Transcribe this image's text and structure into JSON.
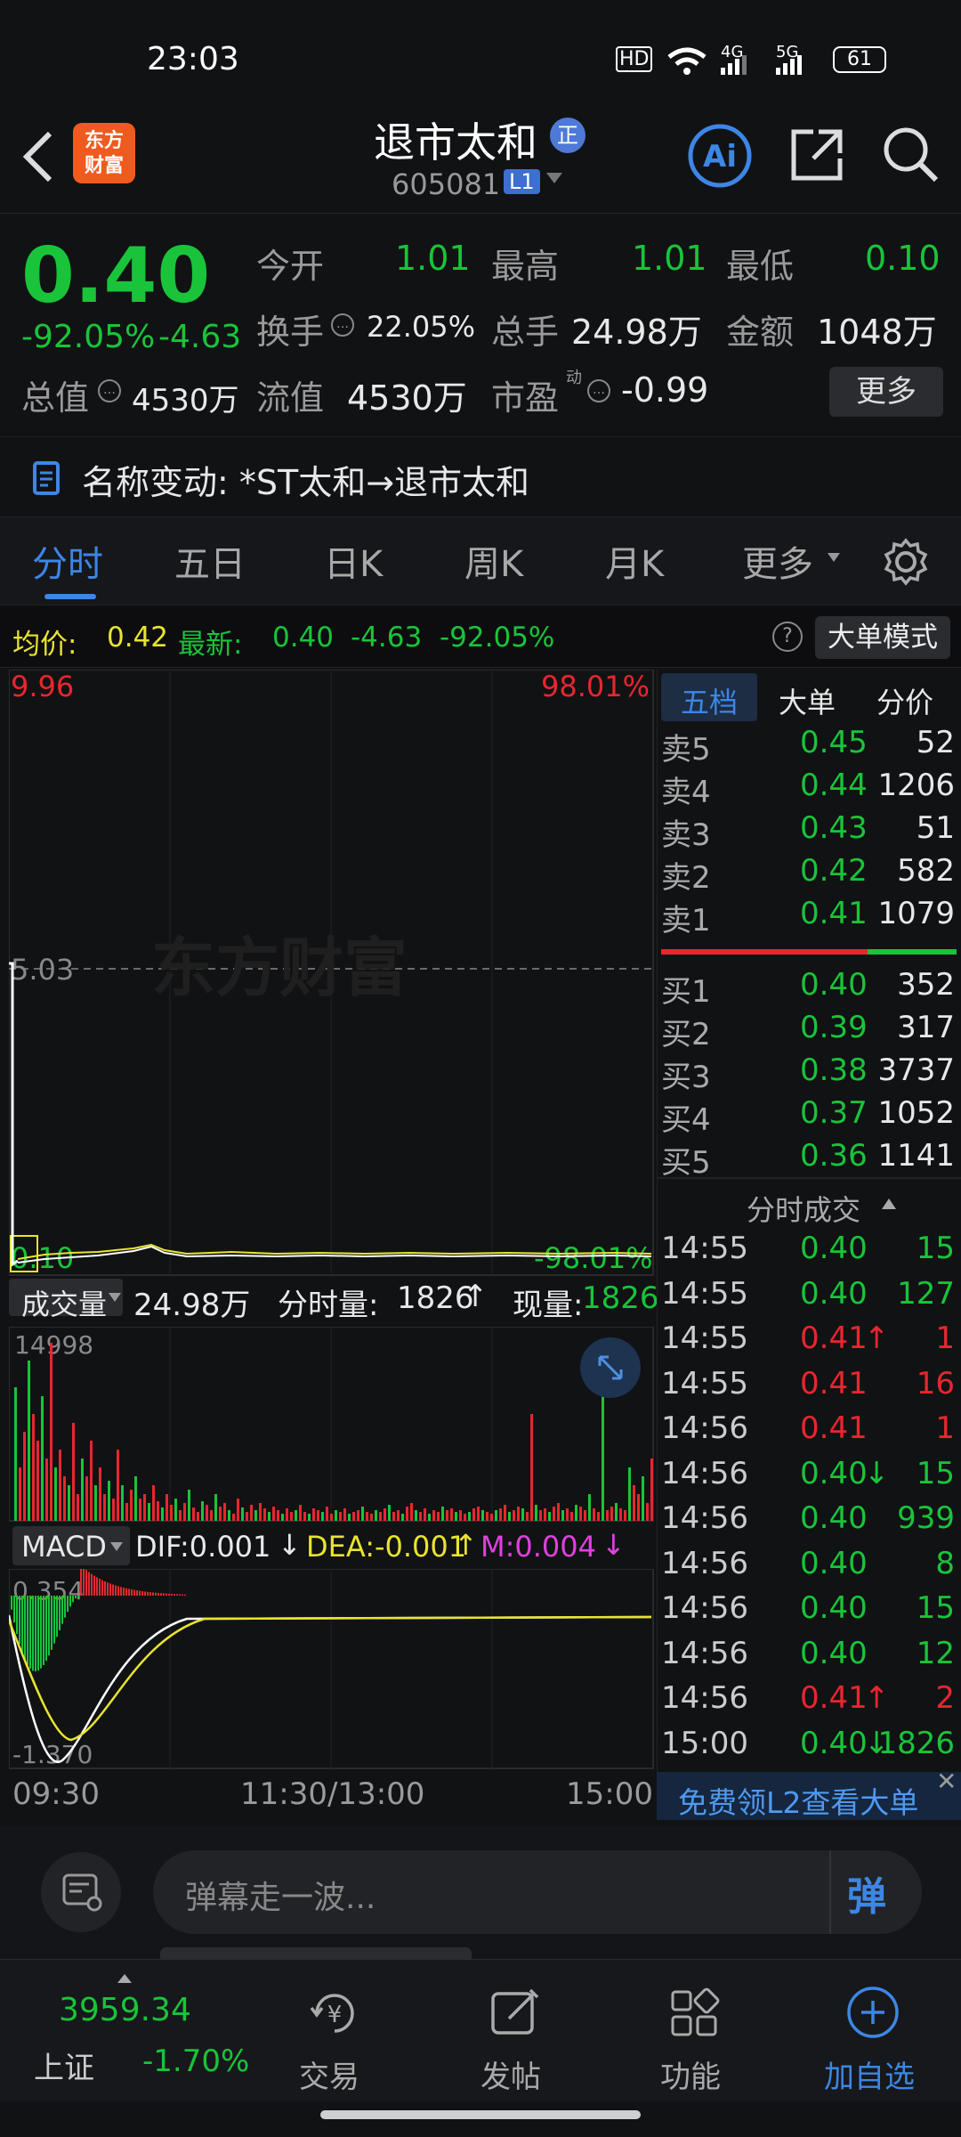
{
  "status_bar": {
    "time": "23:03",
    "battery": "61",
    "net1": "4G",
    "net2": "5G"
  },
  "header": {
    "logo_line1": "东方",
    "logo_line2": "财富",
    "title": "退市太和",
    "title_badge": "正",
    "code": "605081",
    "level": "L1"
  },
  "quote": {
    "price": "0.40",
    "pct": "-92.05%",
    "chg": "-4.63",
    "open_label": "今开",
    "open": "1.01",
    "high_label": "最高",
    "high": "1.01",
    "low_label": "最低",
    "low": "0.10",
    "turnover_label": "换手",
    "turnover": "22.05%",
    "vol_label": "总手",
    "vol": "24.98万",
    "amount_label": "金额",
    "amount": "1048万",
    "mktcap_label": "总值",
    "mktcap": "4530万",
    "float_label": "流值",
    "float": "4530万",
    "pe_label": "市盈",
    "pe_sup": "动",
    "pe": "-0.99",
    "more": "更多"
  },
  "notice": {
    "text": "名称变动: *ST太和→退市太和"
  },
  "tabs": [
    "分时",
    "五日",
    "日K",
    "周K",
    "月K",
    "更多"
  ],
  "indicator": {
    "avg_label": "均价:",
    "avg": "0.42",
    "latest_label": "最新:",
    "latest": "0.40",
    "chg": "-4.63",
    "pct": "-92.05%",
    "mode_btn": "大单模式"
  },
  "chart": {
    "top_price": "9.96",
    "top_pct": "98.01%",
    "mid_price": "5.03",
    "low_price": "0.10",
    "low_pct": "-98.01%",
    "watermark": "东方财富"
  },
  "volume": {
    "label": "成交量",
    "total": "24.98万",
    "tick_label": "分时量:",
    "tick": "1826",
    "now_label": "现量:",
    "now": "1826",
    "max": "14998"
  },
  "macd": {
    "label": "MACD",
    "dif": "DIF:0.001",
    "dea": "DEA:-0.001",
    "m": "M:0.004",
    "top": "0.354",
    "bottom": "-1.370"
  },
  "time_axis": [
    "09:30",
    "11:30/13:00",
    "15:00"
  ],
  "side_tabs": [
    "五档",
    "大单",
    "分价"
  ],
  "asks": [
    {
      "l": "卖5",
      "p": "0.45",
      "v": "52"
    },
    {
      "l": "卖4",
      "p": "0.44",
      "v": "1206"
    },
    {
      "l": "卖3",
      "p": "0.43",
      "v": "51"
    },
    {
      "l": "卖2",
      "p": "0.42",
      "v": "582"
    },
    {
      "l": "卖1",
      "p": "0.41",
      "v": "1079"
    }
  ],
  "bids": [
    {
      "l": "买1",
      "p": "0.40",
      "v": "352"
    },
    {
      "l": "买2",
      "p": "0.39",
      "v": "317"
    },
    {
      "l": "买3",
      "p": "0.38",
      "v": "3737"
    },
    {
      "l": "买4",
      "p": "0.37",
      "v": "1052"
    },
    {
      "l": "买5",
      "p": "0.36",
      "v": "1141"
    }
  ],
  "trades_title": "分时成交",
  "trades": [
    {
      "t": "14:55",
      "p": "0.40",
      "a": "",
      "v": "15",
      "c": "g"
    },
    {
      "t": "14:55",
      "p": "0.40",
      "a": "",
      "v": "127",
      "c": "g"
    },
    {
      "t": "14:55",
      "p": "0.41",
      "a": "↑",
      "v": "1",
      "c": "r"
    },
    {
      "t": "14:55",
      "p": "0.41",
      "a": "",
      "v": "16",
      "c": "r"
    },
    {
      "t": "14:56",
      "p": "0.41",
      "a": "",
      "v": "1",
      "c": "r"
    },
    {
      "t": "14:56",
      "p": "0.40",
      "a": "↓",
      "v": "15",
      "c": "g"
    },
    {
      "t": "14:56",
      "p": "0.40",
      "a": "",
      "v": "939",
      "c": "g"
    },
    {
      "t": "14:56",
      "p": "0.40",
      "a": "",
      "v": "8",
      "c": "g"
    },
    {
      "t": "14:56",
      "p": "0.40",
      "a": "",
      "v": "15",
      "c": "g"
    },
    {
      "t": "14:56",
      "p": "0.40",
      "a": "",
      "v": "12",
      "c": "g"
    },
    {
      "t": "14:56",
      "p": "0.41",
      "a": "↑",
      "v": "2",
      "c": "r"
    },
    {
      "t": "15:00",
      "p": "0.40",
      "a": "↓",
      "v": "1826",
      "c": "g"
    }
  ],
  "l2_banner": "免费领L2查看大单",
  "comment": {
    "placeholder": "弹幕走一波...",
    "btn": "弹"
  },
  "bottom_nav": {
    "index_value": "3959.34",
    "index_name": "上证",
    "index_pct": "-1.70%",
    "items": [
      "交易",
      "发帖",
      "功能",
      "加自选"
    ]
  }
}
